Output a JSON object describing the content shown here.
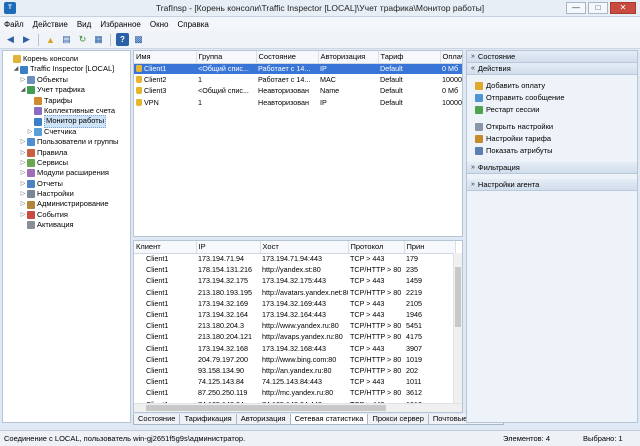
{
  "window": {
    "title": "TrafInsp - [Корень консоли\\Traffic Inspector [LOCAL]\\Учет трафика\\Монитор работы]",
    "minimize": "—",
    "maximize": "□",
    "close": "✕"
  },
  "menu": [
    "Файл",
    "Действие",
    "Вид",
    "Избранное",
    "Окно",
    "Справка"
  ],
  "tree": [
    {
      "label": "Корень консоли",
      "indent": 0,
      "toggle": "",
      "icon": "folder"
    },
    {
      "label": "Traffic Inspector [LOCAL]",
      "indent": 1,
      "toggle": "◢",
      "icon": "server"
    },
    {
      "label": "Объекты",
      "indent": 2,
      "toggle": "▷",
      "icon": "objects"
    },
    {
      "label": "Учет трафика",
      "indent": 2,
      "toggle": "◢",
      "icon": "traffic"
    },
    {
      "label": "Тарифы",
      "indent": 3,
      "toggle": "",
      "icon": "tariff"
    },
    {
      "label": "Коллективные счета",
      "indent": 3,
      "toggle": "",
      "icon": "accounts"
    },
    {
      "label": "Монитор работы",
      "indent": 3,
      "toggle": "",
      "icon": "monitor",
      "selected": true
    },
    {
      "label": "Счетчика",
      "indent": 3,
      "toggle": "▷",
      "icon": "counter"
    },
    {
      "label": "Пользователи и группы",
      "indent": 2,
      "toggle": "▷",
      "icon": "users"
    },
    {
      "label": "Правила",
      "indent": 2,
      "toggle": "▷",
      "icon": "rules"
    },
    {
      "label": "Сервисы",
      "indent": 2,
      "toggle": "▷",
      "icon": "services"
    },
    {
      "label": "Модули расширения",
      "indent": 2,
      "toggle": "▷",
      "icon": "modules"
    },
    {
      "label": "Отчеты",
      "indent": 2,
      "toggle": "▷",
      "icon": "reports"
    },
    {
      "label": "Настройки",
      "indent": 2,
      "toggle": "▷",
      "icon": "settings"
    },
    {
      "label": "Администрирование",
      "indent": 2,
      "toggle": "▷",
      "icon": "admin"
    },
    {
      "label": "События",
      "indent": 2,
      "toggle": "▷",
      "icon": "events"
    },
    {
      "label": "Активация",
      "indent": 2,
      "toggle": "",
      "icon": "activation"
    }
  ],
  "sessions": {
    "columns": [
      "Имя",
      "Группа",
      "Состояние",
      "Авторизация",
      "Тариф",
      "Оплаче"
    ],
    "rows": [
      {
        "cells": [
          "Client1",
          "<Общий спис...",
          "Работает с 14...",
          "IP",
          "Default",
          "0 Мб"
        ],
        "selected": true
      },
      {
        "cells": [
          "Client2",
          "1",
          "Работает с 14...",
          "MAC",
          "Default",
          "10000.00"
        ],
        "selected": false
      },
      {
        "cells": [
          "Client3",
          "<Общий спис...",
          "Неавторизован",
          "Name",
          "Default",
          "0 Мб"
        ],
        "selected": false
      },
      {
        "cells": [
          "VPN",
          "1",
          "Неавторизован",
          "IP",
          "Default",
          "10000.00"
        ],
        "selected": false
      }
    ]
  },
  "connections": {
    "columns": [
      "Клиент",
      "IP",
      "Хост",
      "Протокол",
      "Прин"
    ],
    "rows": [
      [
        "Client1",
        "173.194.71.94",
        "173.194.71.94:443",
        "TCP > 443",
        "179"
      ],
      [
        "Client1",
        "178.154.131.216",
        "http://yandex.st:80",
        "TCP/HTTP > 80",
        "235"
      ],
      [
        "Client1",
        "173.194.32.175",
        "173.194.32.175:443",
        "TCP > 443",
        "1459"
      ],
      [
        "Client1",
        "213.180.193.195",
        "http://avatars.yandex.net:80",
        "TCP/HTTP > 80",
        "2219"
      ],
      [
        "Client1",
        "173.194.32.169",
        "173.194.32.169:443",
        "TCP > 443",
        "2105"
      ],
      [
        "Client1",
        "173.194.32.164",
        "173.194.32.164:443",
        "TCP > 443",
        "1946"
      ],
      [
        "Client1",
        "213.180.204.3",
        "http://www.yandex.ru:80",
        "TCP/HTTP > 80",
        "5451"
      ],
      [
        "Client1",
        "213.180.204.121",
        "http://avaps.yandex.ru:80",
        "TCP/HTTP > 80",
        "4175"
      ],
      [
        "Client1",
        "173.194.32.168",
        "173.194.32.168:443",
        "TCP > 443",
        "3907"
      ],
      [
        "Client1",
        "204.79.197.200",
        "http://www.bing.com:80",
        "TCP/HTTP > 80",
        "1019"
      ],
      [
        "Client1",
        "93.158.134.90",
        "http://an.yandex.ru:80",
        "TCP/HTTP > 80",
        "202"
      ],
      [
        "Client1",
        "74.125.143.84",
        "74.125.143.84:443",
        "TCP > 443",
        "1011"
      ],
      [
        "Client1",
        "87.250.250.119",
        "http://mc.yandex.ru:80",
        "TCP/HTTP > 80",
        "3612"
      ],
      [
        "Client1",
        "74.125.143.94",
        "74.125.143.94:443",
        "TCP > 443",
        "1912"
      ]
    ]
  },
  "tabs": [
    {
      "label": "Состояние",
      "active": false
    },
    {
      "label": "Тарификация",
      "active": false
    },
    {
      "label": "Авторизация",
      "active": false
    },
    {
      "label": "Сетевая статистика",
      "active": true
    },
    {
      "label": "Прокси сервер",
      "active": false
    },
    {
      "label": "Почтовые запросы",
      "active": false
    }
  ],
  "actions": {
    "state_header": "Состояние",
    "actions_header": "Действия",
    "group1": [
      "Добавить оплату",
      "Отправить сообщение",
      "Рестарт сессии"
    ],
    "group2": [
      "Открыть настройки",
      "Настройки тарифа",
      "Показать атрибуты"
    ],
    "filter_header": "Фильтрация",
    "agent_header": "Настройки агента"
  },
  "status": {
    "left": "Соединение с LOCAL, пользователь win-gj2651f5g9s\\администратор.",
    "elements": "Элементов: 4",
    "selected": "Выбрано: 1"
  },
  "colors": {
    "selection": "#3875d7",
    "pane_border": "#b7c4d4",
    "close_button": "#c94a3f"
  }
}
